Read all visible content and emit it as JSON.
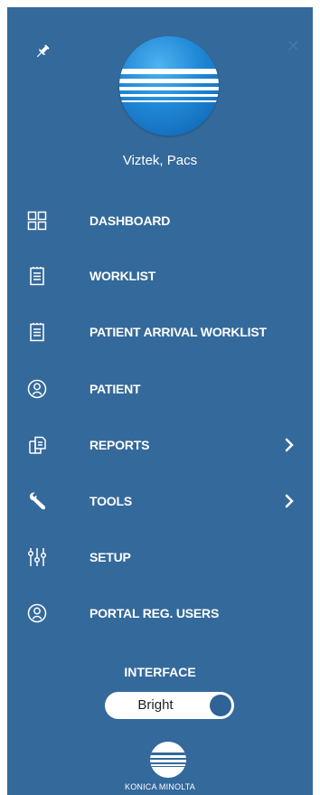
{
  "user": {
    "name": "Viztek, Pacs"
  },
  "menu": {
    "items": [
      {
        "label": "DASHBOARD",
        "icon": "grid-icon",
        "has_submenu": false
      },
      {
        "label": "WORKLIST",
        "icon": "clipboard-icon",
        "has_submenu": false
      },
      {
        "label": "PATIENT ARRIVAL WORKLIST",
        "icon": "clipboard-icon",
        "has_submenu": false
      },
      {
        "label": "PATIENT",
        "icon": "user-circle-icon",
        "has_submenu": false
      },
      {
        "label": "REPORTS",
        "icon": "documents-icon",
        "has_submenu": true
      },
      {
        "label": "TOOLS",
        "icon": "wrench-icon",
        "has_submenu": true
      },
      {
        "label": "SETUP",
        "icon": "sliders-icon",
        "has_submenu": false
      },
      {
        "label": "PORTAL REG. USERS",
        "icon": "user-circle-icon",
        "has_submenu": false
      }
    ]
  },
  "interface": {
    "label": "INTERFACE",
    "mode": "Bright"
  },
  "brand": {
    "name": "KONICA MINOLTA"
  },
  "colors": {
    "panel": "#34699b",
    "text": "#ffffff"
  }
}
